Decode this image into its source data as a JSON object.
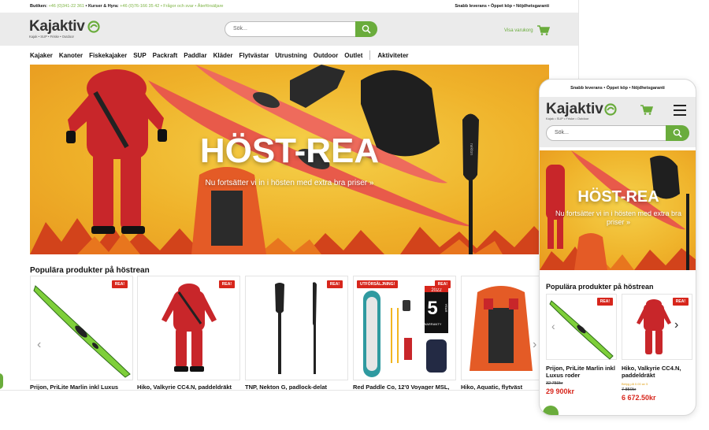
{
  "desktop": {
    "topbar": {
      "store_label": "Butiken:",
      "store_phone": "+46 (0)341-22 361",
      "courses_label": "• Kurser & Hyra:",
      "courses_phone": "+46 (0)76-166 35 42",
      "links": "• Frågor och svar • Återförsäljare",
      "usp": "Snabb leverans • Öppet köp • Nöjdhetsgaranti"
    },
    "header": {
      "logo_text": "Kajaktiv",
      "logo_tagline": "Kajak • SUP • Friske • Outdoor",
      "search_placeholder": "Sök...",
      "cart_label": "Visa varukorg"
    },
    "nav": [
      "Kajaker",
      "Kanoter",
      "Fiskekajaker",
      "SUP",
      "Packraft",
      "Paddlar",
      "Kläder",
      "Flytvästar",
      "Utrustning",
      "Outdoor",
      "Outlet"
    ],
    "nav_extra": "Aktiviteter",
    "hero": {
      "title": "HÖST-REA",
      "subtitle": "Nu fortsätter vi in i hösten med extra bra priser »",
      "paddle_brand": "nekton"
    },
    "section_title": "Populära produkter på höstrean",
    "products": [
      {
        "badge": "REA!",
        "name": "Prijon, PriLite Marlin inkl Luxus"
      },
      {
        "badge": "REA!",
        "name": "Hiko, Valkyrie CC4.N, paddeldräkt"
      },
      {
        "badge": "REA!",
        "name": "TNP, Nekton G, padlock-delat"
      },
      {
        "badge": "REA!",
        "badge2": "UTFÖRSÄLJNING!",
        "name": "Red Paddle Co, 12'0 Voyager MSL,",
        "year": "2022",
        "warranty_num": "5",
        "warranty_text": "WARRANTY",
        "year_word": "YEAR"
      },
      {
        "badge": "",
        "name": "Hiko, Aquatic, flytväst"
      }
    ]
  },
  "mobile": {
    "topbar": "Snabb leverans • Öppet köp • Nöjdhetsgaranti",
    "logo_text": "Kajaktiv",
    "logo_tagline": "Kajak • SUP • Friske • Outdoor",
    "search_placeholder": "Sök...",
    "hero_title": "HÖST-REA",
    "hero_subtitle": "Nu fortsätter vi in i hösten med extra bra priser »",
    "section_title": "Populära produkter på höstrean",
    "products": [
      {
        "badge": "REA!",
        "name": "Prijon, PriLite Marlin inkl Luxus roder",
        "old_price": "32 750kr",
        "price": "29 900kr",
        "note": ""
      },
      {
        "badge": "REA!",
        "name": "Hiko, Valkyrie CC4.N, paddeldräkt",
        "old_price": "7 850kr",
        "price": "6 672.50kr",
        "note": "Betyg på 0.00 av 5"
      }
    ]
  },
  "colors": {
    "brand_green": "#6aac3c",
    "sale_red": "#d7261c",
    "hero_yellow": "#efb22a"
  }
}
